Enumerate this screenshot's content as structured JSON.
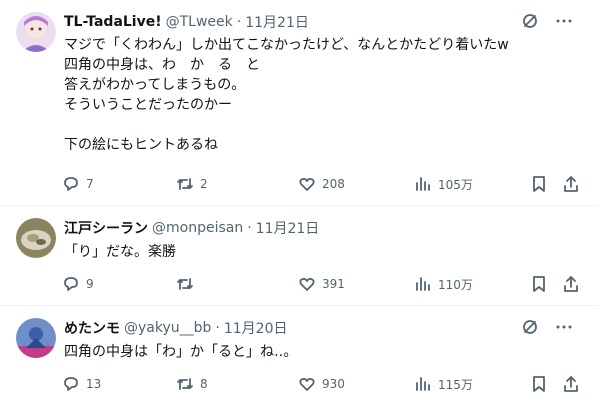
{
  "tweets": [
    {
      "name": "TL-TadaLive!",
      "handle": "@TLweek",
      "separator": "·",
      "date": "11月21日",
      "text": "マジで「くわわん」しか出てこなかったけど、なんとかたどり着いたw\n四角の中身は、わ　か　る　と\n答えがわかってしまうもの。\nそういうことだったのかー\n\n下の絵にもヒントあるね",
      "reply_count": "7",
      "retweet_count": "2",
      "like_count": "208",
      "view_count": "105万"
    },
    {
      "name": "江戸シーラン",
      "handle": "@monpeisan",
      "separator": "·",
      "date": "11月21日",
      "text": "「り」だな。楽勝",
      "reply_count": "9",
      "retweet_count": "",
      "like_count": "391",
      "view_count": "110万"
    },
    {
      "name": "めたンモ",
      "handle": "@yakyu__bb",
      "separator": "·",
      "date": "11月20日",
      "text": "四角の中身は「わ」か「ると」ね‥。",
      "reply_count": "13",
      "retweet_count": "8",
      "like_count": "930",
      "view_count": "115万"
    }
  ],
  "icons": {
    "grok": "grok-icon",
    "more": "more-icon",
    "reply": "reply-icon",
    "retweet": "retweet-icon",
    "like": "like-icon",
    "views": "views-icon",
    "bookmark": "bookmark-icon",
    "share": "share-icon"
  },
  "colors": {
    "text": "#0f1419",
    "secondary": "#536471",
    "divider": "#eff3f4"
  }
}
